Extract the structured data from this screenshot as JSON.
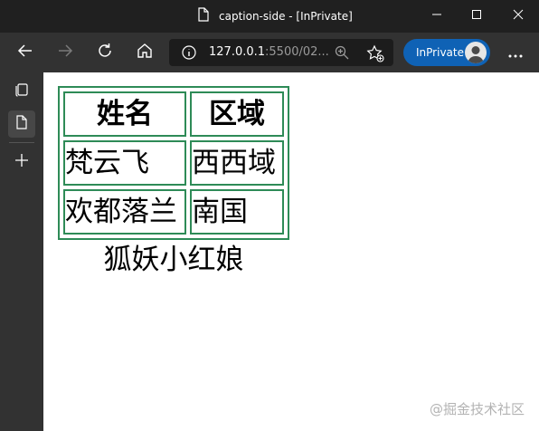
{
  "window": {
    "title": "caption-side - [InPrivate]"
  },
  "toolbar": {
    "url_host": "127.0.0.1",
    "url_rest": ":5500/02...",
    "inprivate_label": "InPrivate"
  },
  "table": {
    "headers": [
      "姓名",
      "区域"
    ],
    "rows": [
      [
        "梵云飞",
        "西西域"
      ],
      [
        "欢都落兰",
        "南国"
      ]
    ],
    "caption": "狐妖小红娘"
  },
  "watermark": "@掘金技术社区",
  "colors": {
    "titlebar": "#202020",
    "toolbar": "#323232",
    "accent": "#0f62b5",
    "table_border": "#2e8b57"
  }
}
